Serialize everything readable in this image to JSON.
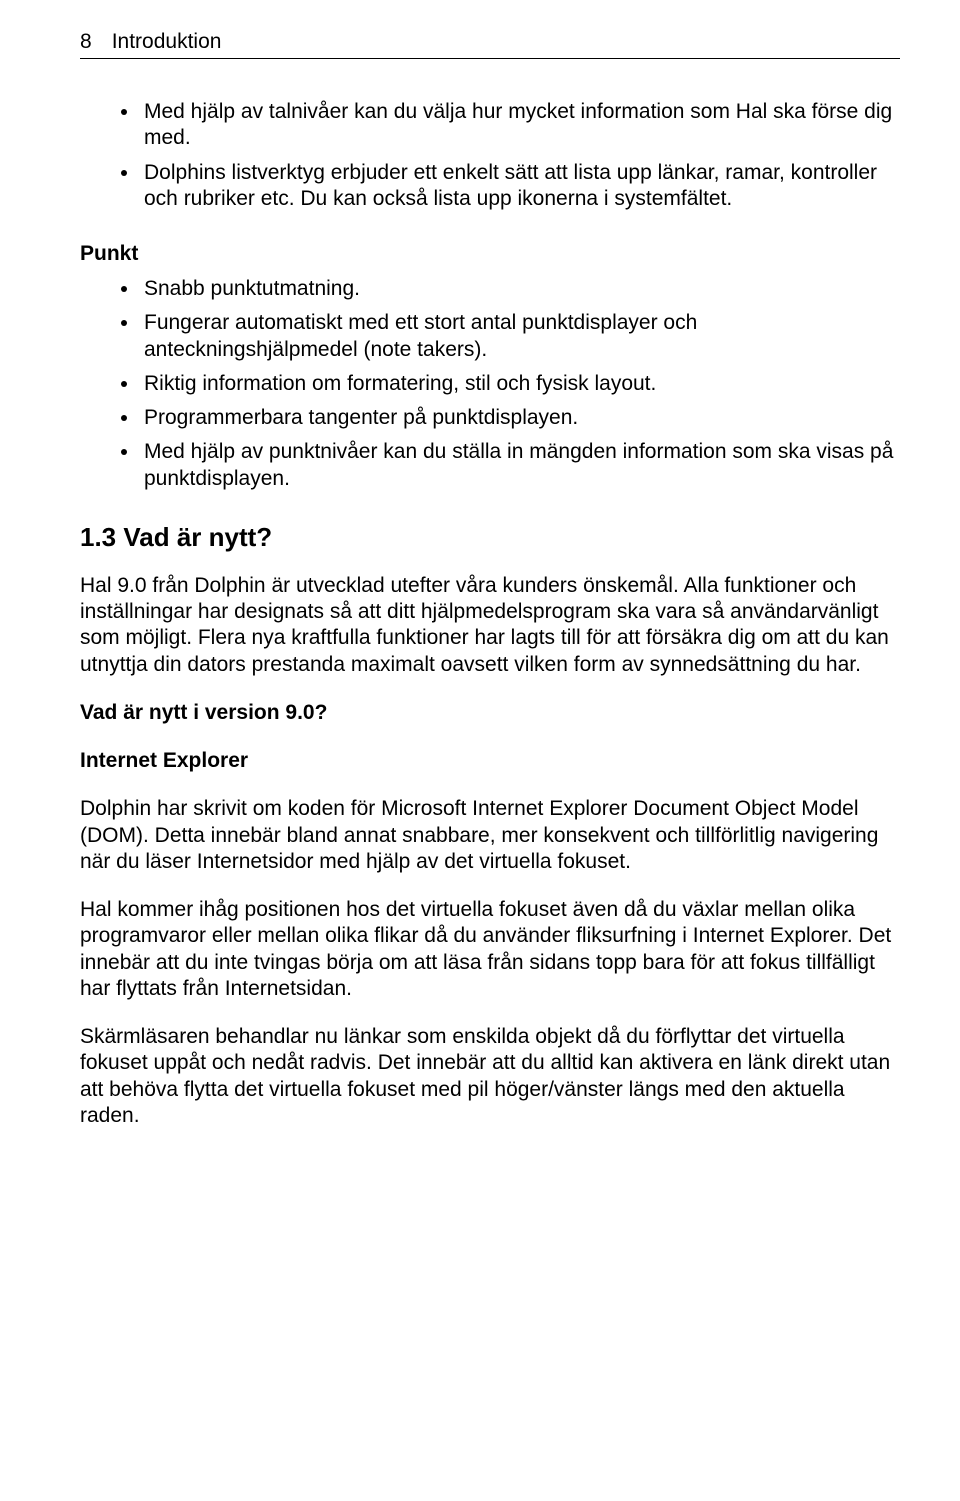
{
  "header": {
    "page_number": "8",
    "title": "Introduktion"
  },
  "top_bullets": [
    "Med hjälp av talnivåer kan du välja hur mycket information som Hal ska förse dig med.",
    "Dolphins listverktyg erbjuder ett enkelt sätt att lista upp länkar, ramar, kontroller och rubriker etc. Du kan också lista upp ikonerna i systemfältet."
  ],
  "punkt_label": "Punkt",
  "punkt_bullets": [
    "Snabb punktutmatning.",
    "Fungerar automatiskt med ett stort antal punktdisplayer och anteckningshjälpmedel (note takers).",
    "Riktig information om formatering, stil och fysisk layout.",
    "Programmerbara tangenter på punktdisplayen.",
    "Med hjälp av punktnivåer kan du ställa in mängden information som ska visas på punktdisplayen."
  ],
  "section_1_3": {
    "heading": "1.3  Vad är nytt?",
    "para1": "Hal 9.0 från Dolphin är utvecklad utefter våra kunders önskemål. Alla funktioner och inställningar har designats så att ditt hjälpmedelsprogram ska vara så användarvänligt som möjligt. Flera nya kraftfulla funktioner har lagts till för att försäkra dig om att du kan utnyttja din dators prestanda maximalt oavsett vilken form av synnedsättning du har.",
    "sub1": "Vad är nytt i version 9.0?",
    "sub2": "Internet Explorer",
    "para2": "Dolphin har skrivit om koden för Microsoft Internet Explorer Document Object Model (DOM). Detta innebär bland annat snabbare, mer konsekvent och tillförlitlig navigering när du läser Internetsidor med hjälp av det virtuella fokuset.",
    "para3": "Hal kommer ihåg positionen hos det virtuella fokuset även då du växlar mellan olika programvaror eller mellan olika flikar då du använder fliksurfning i Internet Explorer. Det innebär att du inte tvingas börja om att läsa från sidans topp bara för att fokus tillfälligt har flyttats från Internetsidan.",
    "para4": "Skärmläsaren behandlar nu länkar som enskilda objekt då du förflyttar det virtuella fokuset uppåt och nedåt radvis. Det innebär att du alltid kan aktivera en länk direkt utan att behöva flytta det virtuella fokuset med pil höger/vänster längs med den aktuella raden."
  }
}
